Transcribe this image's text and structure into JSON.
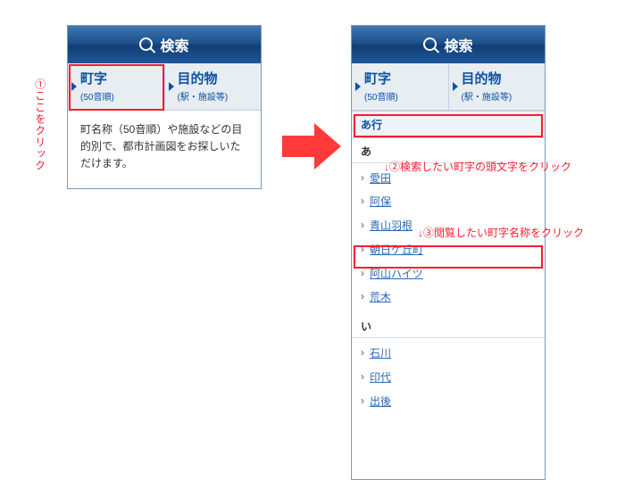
{
  "header": {
    "search_label": "検索",
    "search_icon": "search-icon"
  },
  "tabs": {
    "machiaza_title": "町字",
    "machiaza_sub": "(50音順)",
    "mokuteki_title": "目的物",
    "mokuteki_sub": "(駅・施設等)"
  },
  "description": "町名称（50音順）や施設などの目的別で、都市計画図をお探しいただけます。",
  "sections": {
    "a_gyou": "あ行"
  },
  "letters": {
    "a": "あ",
    "i": "い"
  },
  "listA": [
    "愛田",
    "阿保",
    "青山羽根",
    "朝日ケ丘町",
    "阿山ハイツ",
    "荒木"
  ],
  "listI": [
    "石川",
    "印代",
    "出後"
  ],
  "annotations": {
    "step1_num": "①",
    "step1_text": "ここをクリック",
    "step2": "↓②検索したい町字の頭文字をクリック",
    "step3": "↓③閲覧したい町字名称をクリック"
  }
}
